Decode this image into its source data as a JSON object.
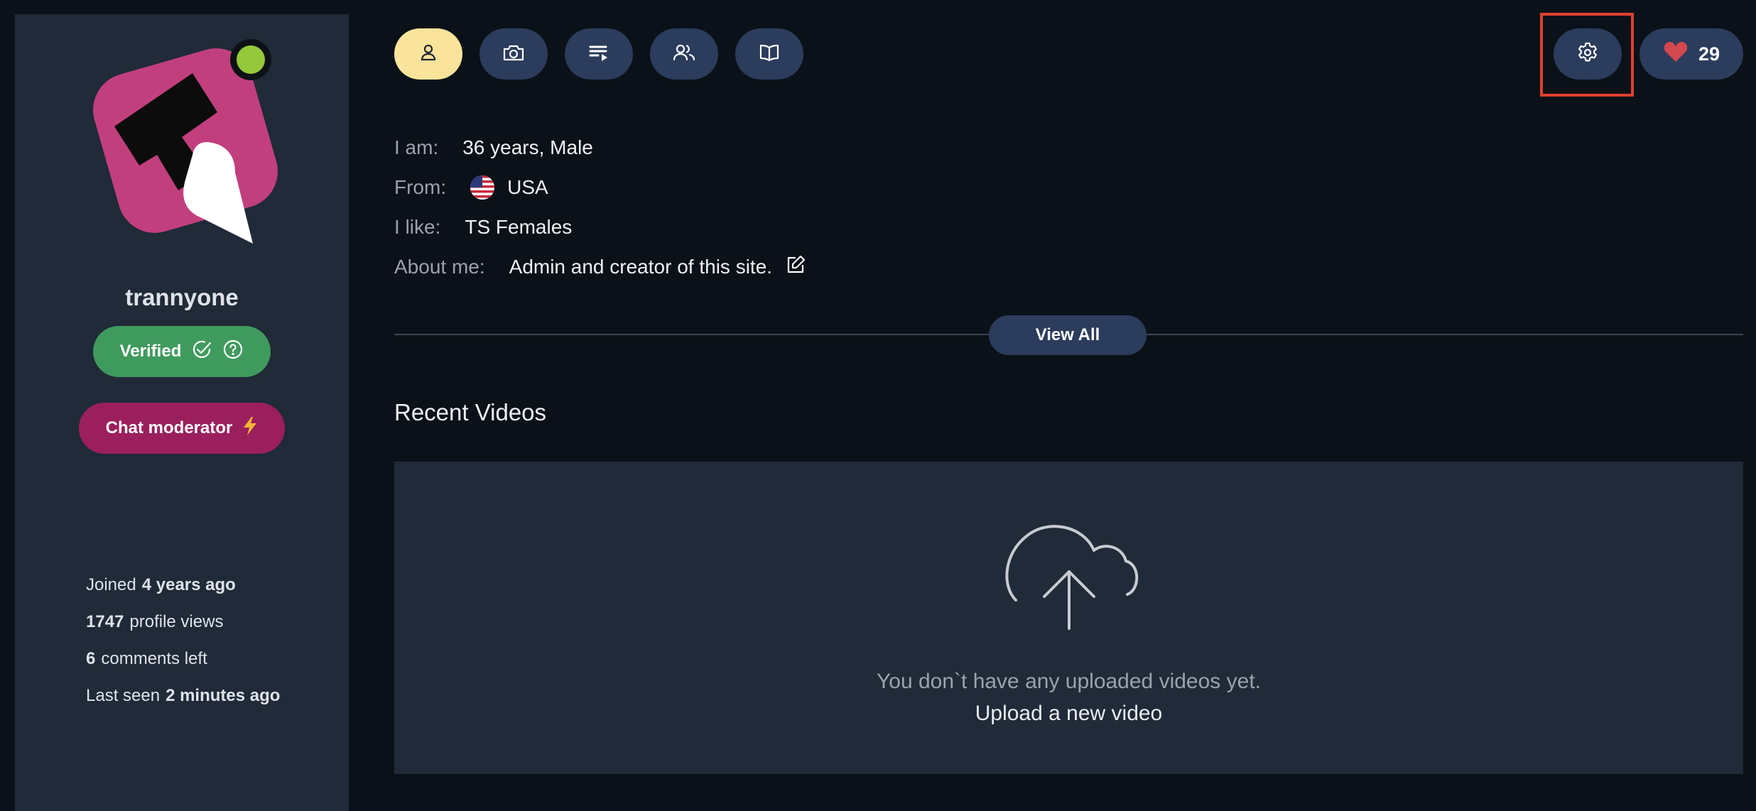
{
  "sidebar": {
    "username": "trannyone",
    "verified_label": "Verified",
    "moderator_label": "Chat moderator",
    "stats": {
      "joined_prefix": "Joined",
      "joined_value": "4 years ago",
      "views_value": "1747",
      "views_suffix": "profile views",
      "comments_value": "6",
      "comments_suffix": "comments left",
      "seen_prefix": "Last seen",
      "seen_value": "2 minutes ago"
    }
  },
  "nav": {
    "tabs": [
      {
        "icon": "user-icon",
        "active": true
      },
      {
        "icon": "camera-icon",
        "active": false
      },
      {
        "icon": "playlist-icon",
        "active": false
      },
      {
        "icon": "friends-icon",
        "active": false
      },
      {
        "icon": "book-icon",
        "active": false
      }
    ],
    "settings_icon": "gear-icon",
    "likes_count": "29"
  },
  "profile": {
    "age_label": "I am:",
    "age_value": "36 years, Male",
    "from_label": "From:",
    "from_value": "USA",
    "like_label": "I like:",
    "like_value": "TS Females",
    "about_label": "About me:",
    "about_value": "Admin and creator of this site."
  },
  "view_all_label": "View All",
  "videos": {
    "title": "Recent Videos",
    "empty_text": "You don`t have any uploaded videos yet.",
    "upload_link": "Upload a new video"
  },
  "colors": {
    "background": "#0b1118",
    "sidebar": "#202a38",
    "nav_button": "#2b3c5c",
    "active_tab": "#fae49b",
    "verified": "#3f9a5d",
    "moderator": "#9b1f5c",
    "online": "#95c93b",
    "highlight": "#e0402e"
  }
}
